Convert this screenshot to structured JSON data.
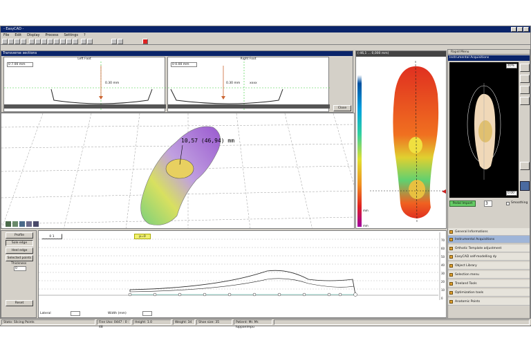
{
  "app": {
    "title": "- EasyCAD -"
  },
  "menu": [
    "File",
    "Edit",
    "Display",
    "Process",
    "Settings",
    "?"
  ],
  "transverse": {
    "title": "Transverse sections",
    "left_label": "Left Foot",
    "right_label": "Right Foot",
    "left_value": "0  7.00 mm",
    "right_value": "0  0.00 mm",
    "left_depth": "0.30 mm",
    "right_depth": "0.30 mm",
    "right_mark": "xxxx",
    "close": "Close"
  },
  "view3d": {
    "readout": "10,57 (46,94) mm"
  },
  "heatmap": {
    "header": "(-46,1 ... 0,000 mm)",
    "scale_max": "mm",
    "scale_min": "mm"
  },
  "rapid": {
    "title": "Rapid Menu",
    "subtitle": "Instrumental Acquisitions",
    "value_top": "40%",
    "value_bottom": "0.00",
    "import_btn": "Pedal Import",
    "spin": "3",
    "smooth": "Smoothing"
  },
  "rapid_items": [
    "General Informations",
    "Instrumental Acquisitions",
    "Orthotic Template adjustment",
    "EasyCAD self-modelling dy",
    "Object Library",
    "Selection menu",
    "Treeland Tools",
    "Optimization tools",
    "Anatomic Points"
  ],
  "bottom_left": [
    "Profile",
    "Sole edge",
    "Heel edge",
    "Selected points",
    "Thickness"
  ],
  "bottom_left_value": "0",
  "bottom_left_btn": "Reset",
  "profile": {
    "tab": "0  1",
    "marker": "p=0",
    "label_left": "Lateral",
    "label_right": "Width (mm)",
    "yticks": [
      "70",
      "60",
      "50",
      "40",
      "30",
      "20",
      "10",
      "0"
    ]
  },
  "status": {
    "cells": [
      "Stato: Slicing Points",
      "Fine Uso: 0447 : 0 : 48",
      "Height: 1.0",
      "Weight: 34",
      "Shoe size: 35",
      "Patient: Mr. Mr. Iuppanimpu"
    ]
  }
}
